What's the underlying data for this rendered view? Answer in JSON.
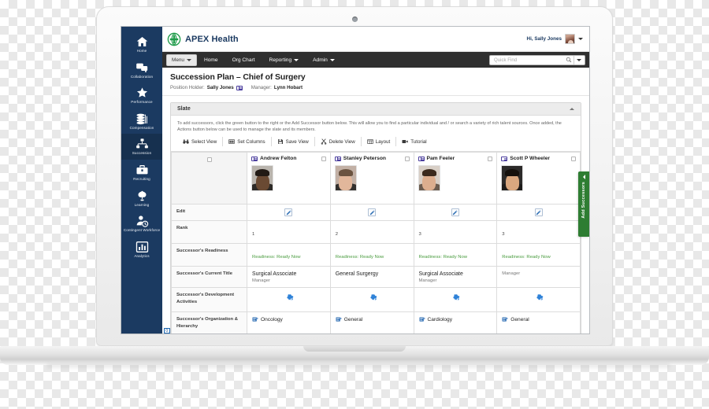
{
  "sidebar": {
    "items": [
      {
        "label": "Home",
        "icon": "home-icon",
        "active": false
      },
      {
        "label": "Collaboration",
        "icon": "chat-icon",
        "active": false
      },
      {
        "label": "Performance",
        "icon": "star-icon",
        "active": false
      },
      {
        "label": "Compensation",
        "icon": "coins-icon",
        "active": false
      },
      {
        "label": "Succession",
        "icon": "succession-icon",
        "active": true
      },
      {
        "label": "Recruiting",
        "icon": "briefcase-icon",
        "active": false
      },
      {
        "label": "Learning",
        "icon": "learning-icon",
        "active": false
      },
      {
        "label": "Contingent Workforce",
        "icon": "person-clock-icon",
        "active": false
      },
      {
        "label": "Analytics",
        "icon": "bar-chart-icon",
        "active": false
      }
    ]
  },
  "brandbar": {
    "logo_icon": "apex-health-logo",
    "brand": "APEX Health",
    "greeting": "Hi, Sally Jones",
    "avatar_icon": "user-avatar",
    "caret_icon": "chevron-down-icon"
  },
  "navbar": {
    "menu_label": "Menu",
    "links": [
      {
        "label": "Home",
        "has_caret": false
      },
      {
        "label": "Org Chart",
        "has_caret": false
      },
      {
        "label": "Reporting",
        "has_caret": true
      },
      {
        "label": "Admin",
        "has_caret": true
      }
    ],
    "search": {
      "placeholder": "Quick Find",
      "value": "",
      "icon": "search-icon",
      "dropdown_icon": "chevron-down-icon"
    }
  },
  "page": {
    "title": "Succession Plan – Chief of Surgery",
    "position_holder_label": "Position Holder:",
    "position_holder": "Sally Jones",
    "position_holder_icon": "business-card-icon",
    "manager_label": "Manager:",
    "manager": "Lynn Hobart"
  },
  "panel": {
    "title": "Slate",
    "collapse_icon": "chevron-up-icon",
    "description": "To add successors, click the green button to the right or the Add Successor button below. This will allow you to find a particular individual and / or search a variety of rich talent sources. Once added, the Actions button below can be used to manage the slate and its members.",
    "toolbar": [
      {
        "label": "Select View",
        "icon": "binoculars-icon"
      },
      {
        "label": "Set Columns",
        "icon": "columns-icon"
      },
      {
        "label": "Save View",
        "icon": "save-icon"
      },
      {
        "label": "Delete View",
        "icon": "scissors-icon"
      },
      {
        "label": "Layout",
        "icon": "layout-icon"
      },
      {
        "label": "Tutorial",
        "icon": "video-icon"
      }
    ]
  },
  "add_successors_tab": {
    "label": "Add Successors",
    "arrow_icon": "chevron-left-icon",
    "color": "#2e7d32"
  },
  "table": {
    "row_labels": [
      "Edit",
      "Rank",
      "Successor's Readiness",
      "Successor's Current Title",
      "Successor's Development Activities",
      "Successor's Organization & Hierarchy"
    ],
    "successors": [
      {
        "name": "Andrew Felton",
        "card_icon": "business-card-icon",
        "checkbox_checked": false,
        "photo_icon": "person-photo",
        "edit_icon": "pencil-icon",
        "rank": "1",
        "readiness": "Readiness: Ready Now",
        "current_title": "Surgical Associate",
        "current_title_sub": "Manager",
        "development_count": "1",
        "development_icon": "development-badge-icon",
        "organization": "Oncology",
        "organization_icon": "org-chart-icon",
        "photo": {
          "bg": "#b9b4ad",
          "skin": "#6a4a33",
          "hair": "#221a14",
          "body": "#2d2a27"
        }
      },
      {
        "name": "Stanley Peterson",
        "card_icon": "business-card-icon",
        "checkbox_checked": false,
        "photo_icon": "person-photo",
        "edit_icon": "pencil-icon",
        "rank": "2",
        "readiness": "Readiness: Ready Now",
        "current_title": "General Surgergy",
        "current_title_sub": "",
        "development_count": "0",
        "development_icon": "development-badge-icon",
        "organization": "General",
        "organization_icon": "org-chart-icon",
        "photo": {
          "bg": "#c2b0a5",
          "skin": "#e2b79b",
          "hair": "#6b5340",
          "body": "#33302e"
        }
      },
      {
        "name": "Pam Feeler",
        "card_icon": "business-card-icon",
        "checkbox_checked": false,
        "photo_icon": "person-photo",
        "edit_icon": "pencil-icon",
        "rank": "3",
        "readiness": "Readiness: Ready Now",
        "current_title": "Surgical Associate",
        "current_title_sub": "Manager",
        "development_count": "0",
        "development_icon": "development-badge-icon",
        "organization": "Cardiology",
        "organization_icon": "org-chart-icon",
        "photo": {
          "bg": "#d8cfc6",
          "skin": "#dcae8e",
          "hair": "#3b2a1d",
          "body": "#6b5c4f"
        }
      },
      {
        "name": "Scott P Wheeler",
        "card_icon": "business-card-icon",
        "checkbox_checked": false,
        "photo_icon": "person-photo",
        "edit_icon": "pencil-icon",
        "rank": "3",
        "readiness": "Readiness: Ready Now",
        "current_title": "",
        "current_title_sub": "Manager",
        "development_count": "0",
        "development_icon": "development-badge-icon",
        "organization": "General",
        "organization_icon": "org-chart-icon",
        "photo": {
          "bg": "#2c2a29",
          "skin": "#d9a77f",
          "hair": "#15100c",
          "body": "#1d1b1a"
        }
      }
    ]
  }
}
